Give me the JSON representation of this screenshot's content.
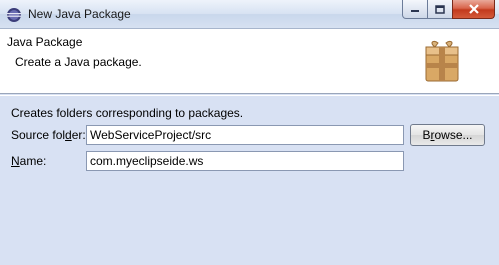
{
  "window": {
    "title": "New Java Package",
    "icon": "eclipse-icon",
    "controls": [
      "minimize-icon",
      "maximize-icon",
      "close-icon"
    ]
  },
  "header": {
    "title": "Java Package",
    "description": "Create a Java package.",
    "icon": "package-icon"
  },
  "form": {
    "info": "Creates folders corresponding to packages.",
    "source_folder": {
      "label_pre": "Source fol",
      "label_mnemonic": "d",
      "label_post": "er:",
      "value": "WebServiceProject/src"
    },
    "name": {
      "label_mnemonic": "N",
      "label_post": "ame:",
      "value": "com.myeclipseide.ws"
    },
    "browse_pre": "B",
    "browse_mnemonic": "r",
    "browse_post": "owse..."
  },
  "colors": {
    "body_bg": "#d8e1f3",
    "header_bg": "#ffffff",
    "close_button": "#c23a1d"
  }
}
